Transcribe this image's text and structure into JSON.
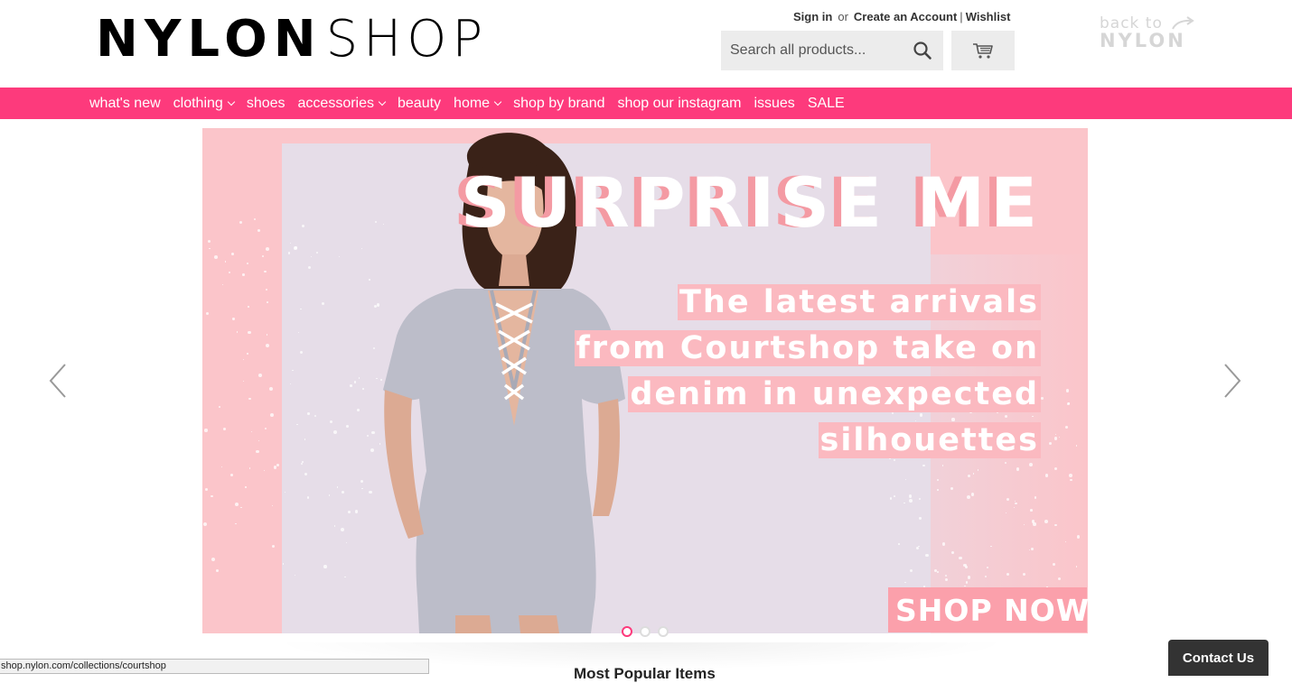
{
  "logo": {
    "bold": "NYLON",
    "thin": "SHOP"
  },
  "account": {
    "sign_in": "Sign in",
    "or": "or",
    "create": "Create an Account",
    "separator": "|",
    "wishlist": "Wishlist"
  },
  "search": {
    "placeholder": "Search all products...",
    "icon": "search-icon"
  },
  "cart": {
    "icon": "cart-icon"
  },
  "back_to_nylon": {
    "back": "back to",
    "brand": "NYLON"
  },
  "nav": {
    "items": [
      {
        "label": "what's new",
        "dropdown": false
      },
      {
        "label": "clothing",
        "dropdown": true
      },
      {
        "label": "shoes",
        "dropdown": false
      },
      {
        "label": "accessories",
        "dropdown": true
      },
      {
        "label": "beauty",
        "dropdown": false
      },
      {
        "label": "home",
        "dropdown": true
      },
      {
        "label": "shop by brand",
        "dropdown": false
      },
      {
        "label": "shop our instagram",
        "dropdown": false
      },
      {
        "label": "issues",
        "dropdown": false
      },
      {
        "label": "SALE",
        "dropdown": false
      }
    ]
  },
  "hero": {
    "headline": "SURPRISE ME",
    "tagline_lines": [
      "The latest arrivals",
      "from Courtshop take on",
      "denim in unexpected",
      "silhouettes"
    ],
    "cta": "SHOP NOW",
    "slide_count": 3,
    "active_slide": 1
  },
  "section": {
    "popular_title": "Most Popular Items"
  },
  "status_bar": {
    "url": "shop.nylon.com/collections/courtshop"
  },
  "contact": {
    "label": "Contact Us"
  },
  "colors": {
    "accent": "#fd3a7c",
    "hero_pink": "#fbc5ca",
    "hero_lilac": "#e6dde8",
    "cta_bg": "#fba0ab"
  }
}
